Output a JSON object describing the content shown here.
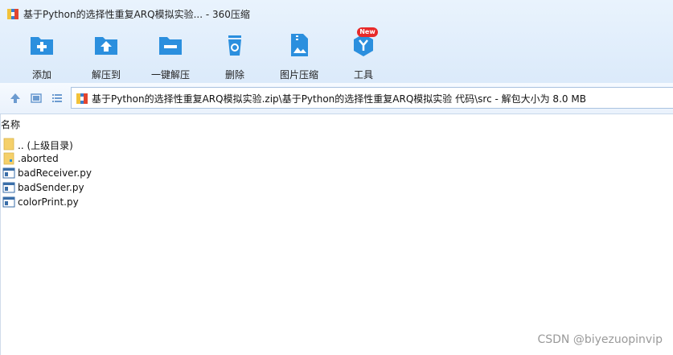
{
  "window": {
    "title": "基于Python的选择性重复ARQ模拟实验... - 360压缩"
  },
  "toolbar": {
    "items": [
      {
        "label": "添加",
        "icon": "add-icon"
      },
      {
        "label": "解压到",
        "icon": "extract-to-icon"
      },
      {
        "label": "一键解压",
        "icon": "one-click-extract-icon"
      },
      {
        "label": "删除",
        "icon": "delete-icon"
      },
      {
        "label": "图片压缩",
        "icon": "image-compress-icon"
      },
      {
        "label": "工具",
        "icon": "tools-icon",
        "badge": "New"
      }
    ]
  },
  "address": {
    "path": "基于Python的选择性重复ARQ模拟实验.zip\\基于Python的选择性重复ARQ模拟实验 代码\\src - 解包大小为 8.0 MB"
  },
  "list": {
    "column_name": "名称",
    "rows": [
      {
        "name": ".. (上级目录)",
        "type": "parent-folder"
      },
      {
        "name": ".aborted",
        "type": "file"
      },
      {
        "name": "badReceiver.py",
        "type": "py"
      },
      {
        "name": "badSender.py",
        "type": "py"
      },
      {
        "name": "colorPrint.py",
        "type": "py"
      }
    ]
  },
  "watermark": "CSDN @biyezuopinvip",
  "colors": {
    "accent": "#2b8fde",
    "badge": "#e82a2a",
    "folder": "#f5d06a"
  }
}
